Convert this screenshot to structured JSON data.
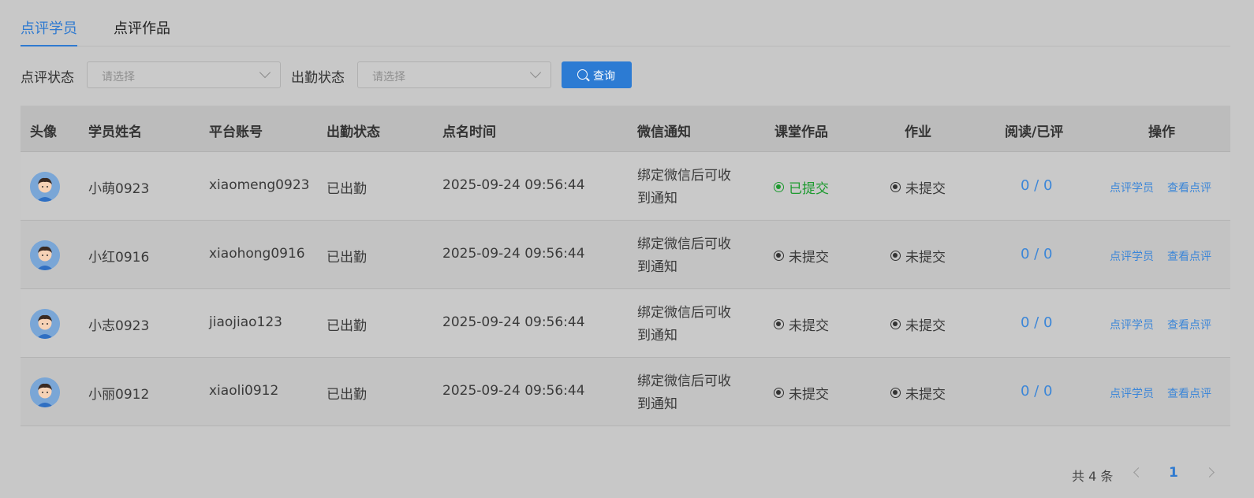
{
  "tabs": [
    {
      "label": "点评学员",
      "active": true
    },
    {
      "label": "点评作品",
      "active": false
    }
  ],
  "filters": {
    "review_status": {
      "label": "点评状态",
      "placeholder": "请选择"
    },
    "attendance_status": {
      "label": "出勤状态",
      "placeholder": "请选择"
    },
    "query_button": "查询"
  },
  "table": {
    "headers": [
      "头像",
      "学员姓名",
      "平台账号",
      "出勤状态",
      "点名时间",
      "微信通知",
      "课堂作品",
      "作业",
      "阅读/已评",
      "操作"
    ],
    "rows": [
      {
        "name": "小萌0923",
        "account": "xiaomeng0923",
        "attendance": "已出勤",
        "time": "2025-09-24 09:56:44",
        "wechat": "绑定微信后可收到通知",
        "classwork": "已提交",
        "homework": "未提交",
        "ratio": "0 / 0",
        "action1": "点评学员",
        "action2": "查看点评"
      },
      {
        "name": "小红0916",
        "account": "xiaohong0916",
        "attendance": "已出勤",
        "time": "2025-09-24 09:56:44",
        "wechat": "绑定微信后可收到通知",
        "classwork": "未提交",
        "homework": "未提交",
        "ratio": "0 / 0",
        "action1": "点评学员",
        "action2": "查看点评"
      },
      {
        "name": "小志0923",
        "account": "jiaojiao123",
        "attendance": "已出勤",
        "time": "2025-09-24 09:56:44",
        "wechat": "绑定微信后可收到通知",
        "classwork": "未提交",
        "homework": "未提交",
        "ratio": "0 / 0",
        "action1": "点评学员",
        "action2": "查看点评"
      },
      {
        "name": "小丽0912",
        "account": "xiaoli0912",
        "attendance": "已出勤",
        "time": "2025-09-24 09:56:44",
        "wechat": "绑定微信后可收到通知",
        "classwork": "未提交",
        "homework": "未提交",
        "ratio": "0 / 0",
        "action1": "点评学员",
        "action2": "查看点评"
      }
    ]
  },
  "pagination": {
    "total": "共 4 条",
    "current_page": "1"
  },
  "colors": {
    "accent": "#2c7bd3",
    "highlight": "#e03b82",
    "submitted": "#1d9a2f"
  }
}
